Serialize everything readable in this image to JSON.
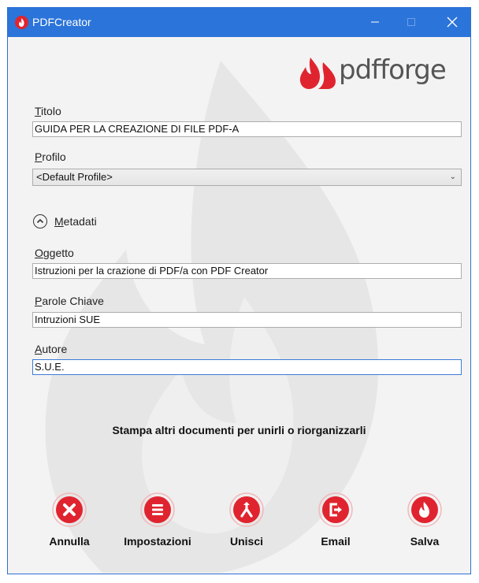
{
  "window": {
    "title": "PDFCreator"
  },
  "brand": {
    "logo_text": "pdfforge"
  },
  "form": {
    "title": {
      "label_accel": "T",
      "label_rest": "itolo",
      "value": "GUIDA PER LA CREAZIONE DI FILE PDF-A"
    },
    "profile": {
      "label_accel": "P",
      "label_rest": "rofilo",
      "selected": "<Default Profile>"
    },
    "metadata": {
      "label_accel": "M",
      "label_rest": "etadati"
    },
    "subject": {
      "label_accel": "O",
      "label_rest": "ggetto",
      "value": "Istruzioni per la crazione di PDF/a con PDF Creator"
    },
    "keywords": {
      "label_accel": "P",
      "label_rest": "arole Chiave",
      "value": "Intruzioni SUE"
    },
    "author": {
      "label_accel": "A",
      "label_rest": "utore",
      "value": "S.U.E."
    }
  },
  "hint": "Stampa altri documenti per unirli o riorganizzarli",
  "actions": {
    "cancel": "Annulla",
    "settings": "Impostazioni",
    "merge": "Unisci",
    "email": "Email",
    "save": "Salva"
  },
  "colors": {
    "titlebar": "#2b74d9",
    "accent_red": "#e0242f",
    "background": "#f3f3f3"
  },
  "icons": [
    "app-flame-icon",
    "minimize-icon",
    "maximize-icon",
    "close-icon",
    "chevron-up-icon",
    "chevron-down-icon",
    "cancel-x-icon",
    "settings-list-icon",
    "merge-icon",
    "email-icon",
    "save-flame-icon"
  ]
}
